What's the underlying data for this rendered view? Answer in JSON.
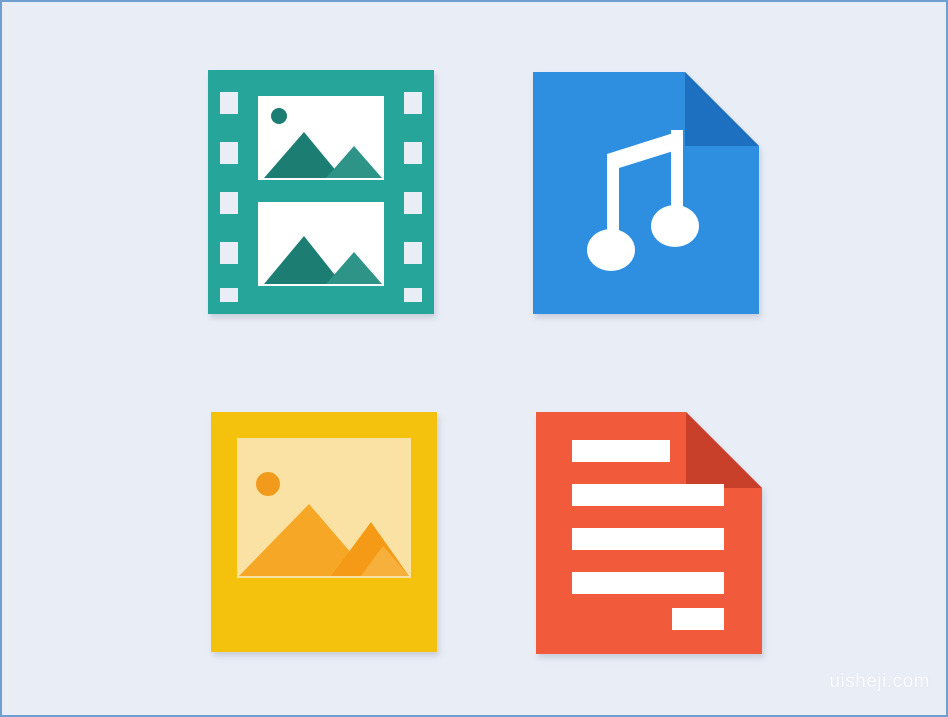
{
  "colors": {
    "background": "#e9edf6",
    "border": "#6f9fd0",
    "video": "#26a69a",
    "audio": "#2d8fe0",
    "image": "#f4c10e",
    "document": "#f15a3a"
  },
  "icons": [
    {
      "name": "video-file-icon"
    },
    {
      "name": "audio-file-icon"
    },
    {
      "name": "image-file-icon"
    },
    {
      "name": "document-file-icon"
    }
  ],
  "watermark": "uisheji.com"
}
